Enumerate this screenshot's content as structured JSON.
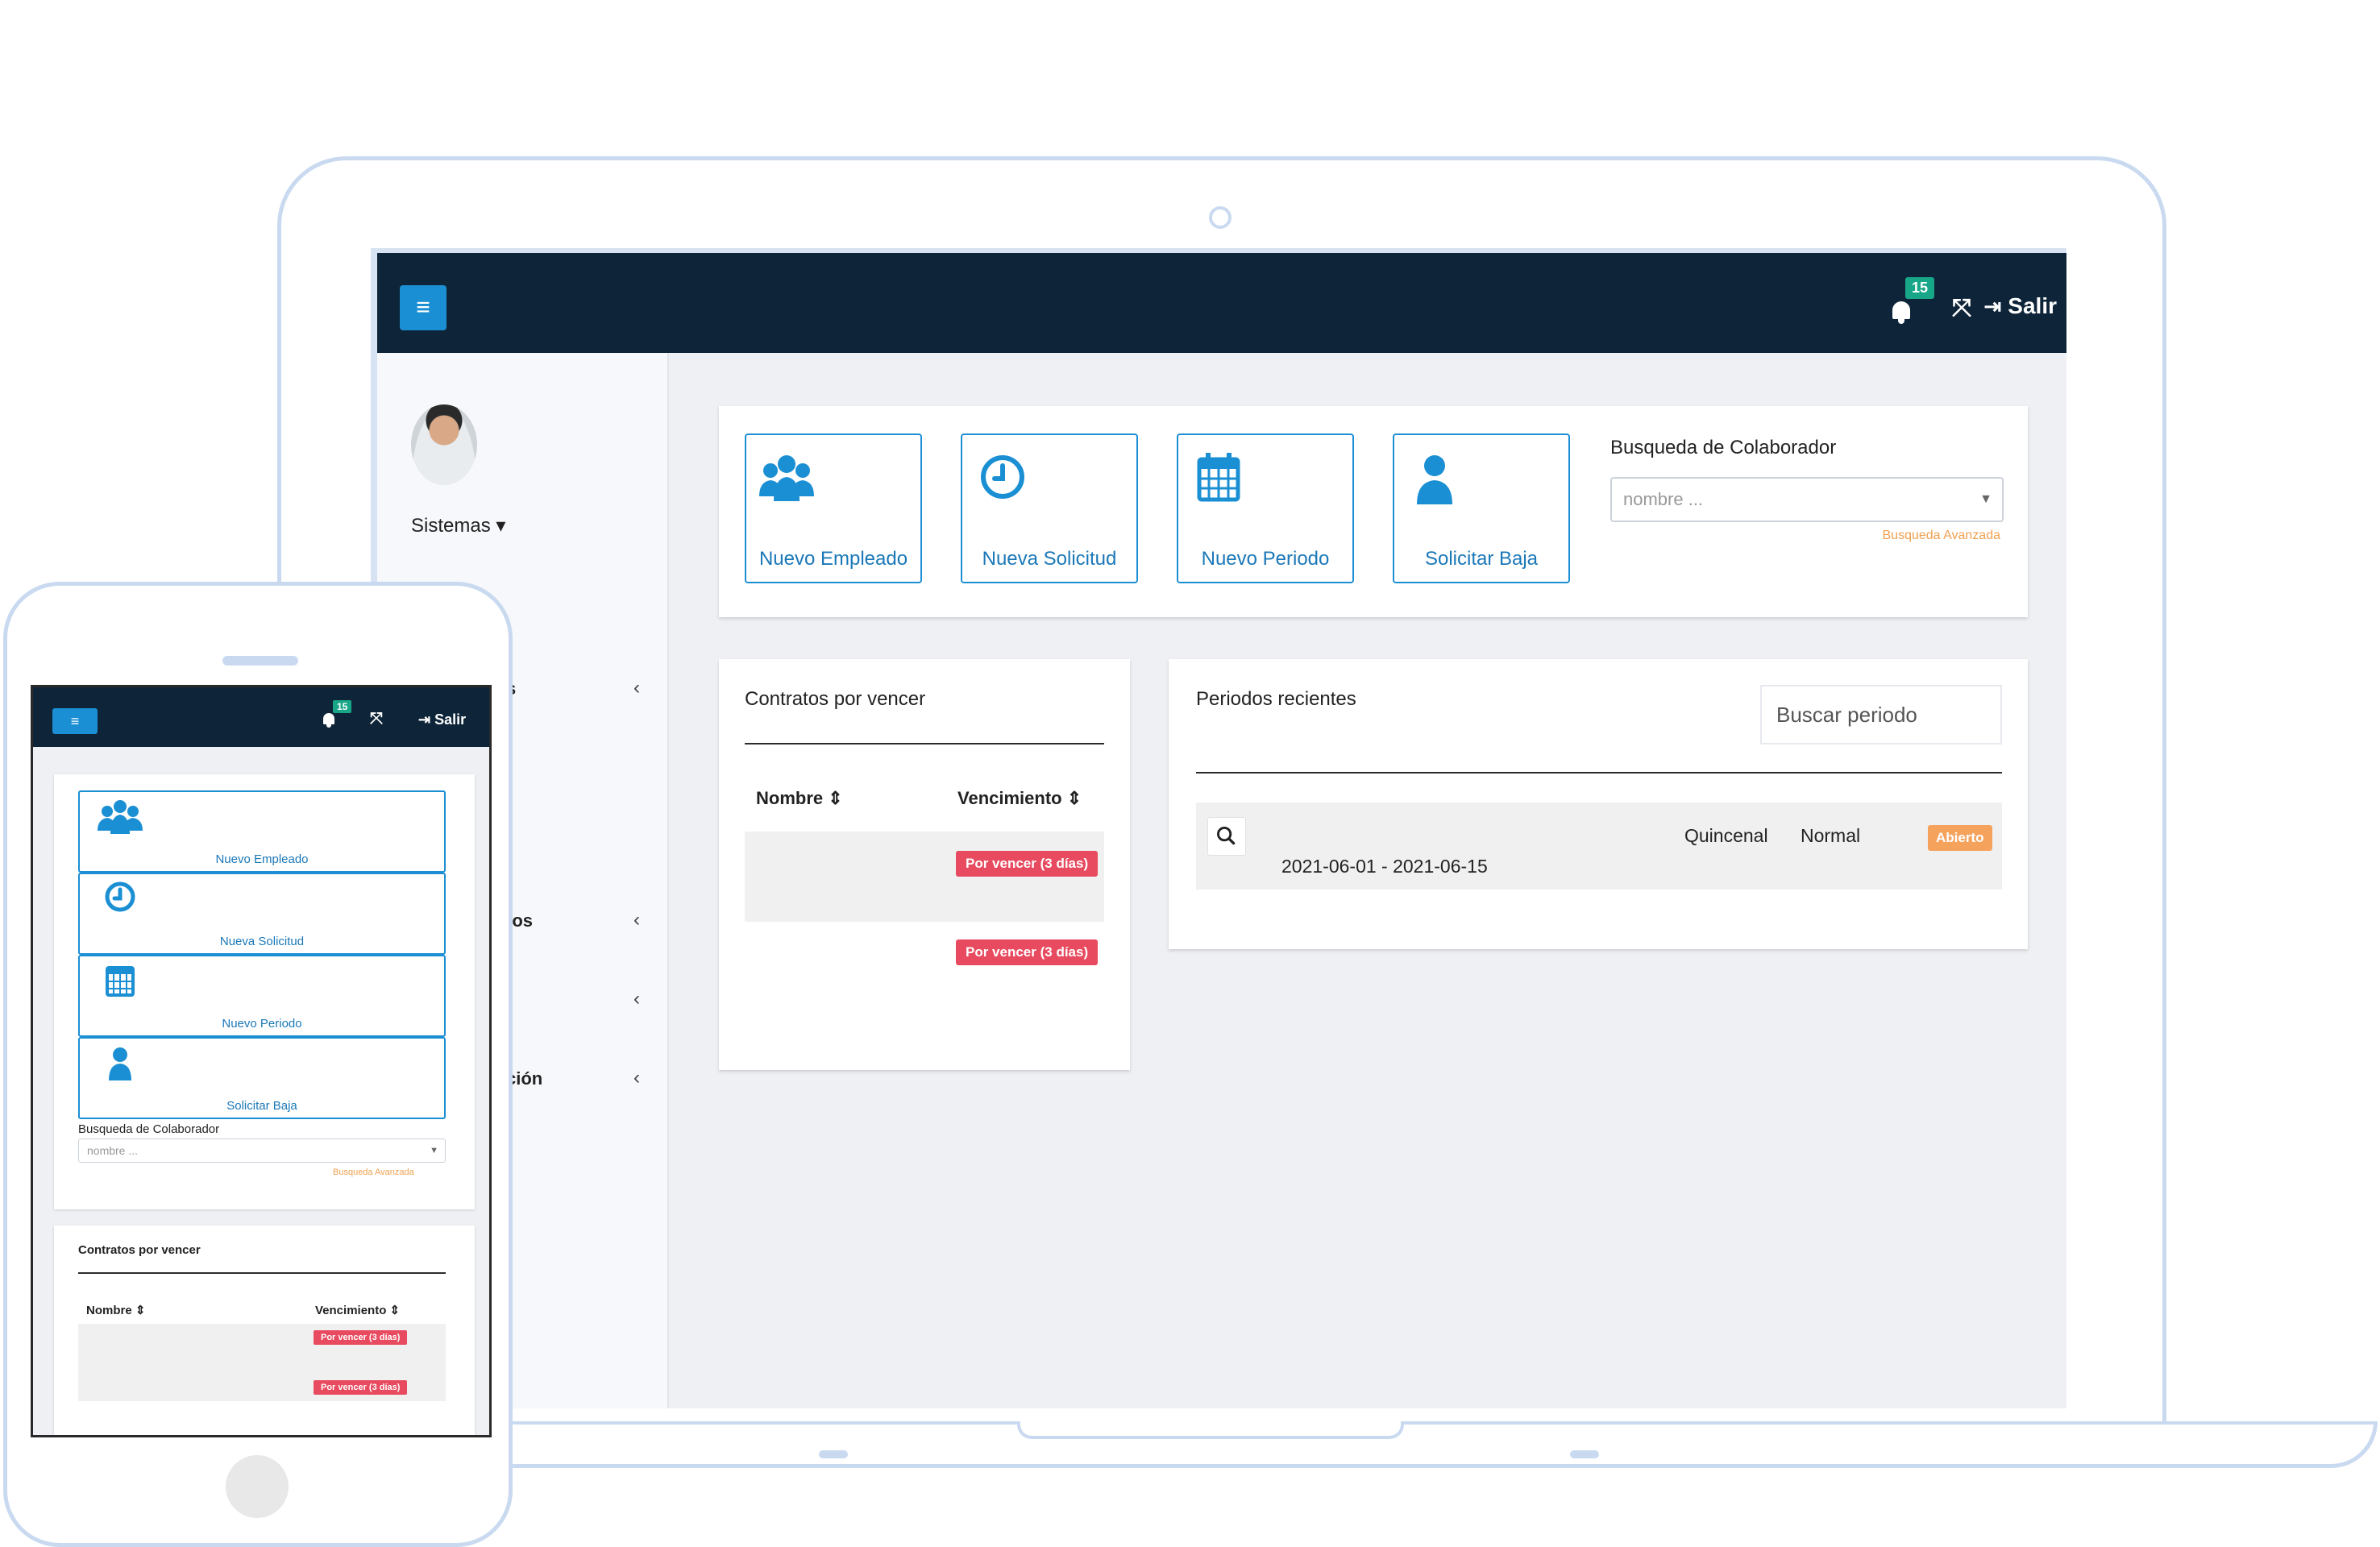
{
  "laptop": {
    "topbar": {
      "menu_icon": "hamburger-icon",
      "notification_count": "15",
      "logout_label": "Salir"
    },
    "sidebar": {
      "user_menu_label": "Sistemas",
      "partial_items": [
        {
          "label": "s",
          "chevron": "‹"
        },
        {
          "label": "tos",
          "chevron": "‹"
        },
        {
          "label": "",
          "chevron": "‹"
        },
        {
          "label": "ción",
          "chevron": "‹"
        }
      ]
    },
    "quick_actions": [
      {
        "label": "Nuevo Empleado",
        "icon": "users-icon"
      },
      {
        "label": "Nueva Solicitud",
        "icon": "clock-icon"
      },
      {
        "label": "Nuevo Periodo",
        "icon": "calendar-icon"
      },
      {
        "label": "Solicitar Baja",
        "icon": "user-icon"
      }
    ],
    "employee_search": {
      "label": "Busqueda de Colaborador",
      "placeholder": "nombre ...",
      "advanced_link": "Busqueda Avanzada"
    },
    "contracts": {
      "title": "Contratos por vencer",
      "columns": [
        "Nombre",
        "Vencimiento"
      ],
      "rows": [
        {
          "name": "",
          "status": "Por vencer (3 días)"
        },
        {
          "name": "",
          "status": "Por vencer (3 días)"
        }
      ]
    },
    "periods": {
      "title": "Periodos recientes",
      "search_placeholder": "Buscar periodo",
      "rows": [
        {
          "range": "2021-06-01 - 2021-06-15",
          "frequency": "Quincenal",
          "type": "Normal",
          "status": "Abierto"
        }
      ]
    }
  },
  "phone": {
    "topbar": {
      "notification_count": "15",
      "logout_label": "Salir"
    },
    "quick_actions": [
      {
        "label": "Nuevo Empleado",
        "icon": "users-icon"
      },
      {
        "label": "Nueva Solicitud",
        "icon": "clock-icon"
      },
      {
        "label": "Nuevo Periodo",
        "icon": "calendar-icon"
      },
      {
        "label": "Solicitar Baja",
        "icon": "user-icon"
      }
    ],
    "employee_search": {
      "label": "Busqueda de Colaborador",
      "placeholder": "nombre ...",
      "advanced_link": "Busqueda Avanzada"
    },
    "contracts": {
      "title": "Contratos por vencer",
      "columns": [
        "Nombre",
        "Vencimiento"
      ],
      "rows": [
        {
          "status": "Por vencer (3 días)"
        },
        {
          "status": "Por vencer (3 días)"
        }
      ]
    }
  },
  "colors": {
    "topbar": "#0e2438",
    "primary": "#1b8fd3",
    "badge_green": "#18a689",
    "badge_red": "#e84a5f",
    "badge_orange": "#f5a25d",
    "device_outline": "#c9daf0"
  }
}
